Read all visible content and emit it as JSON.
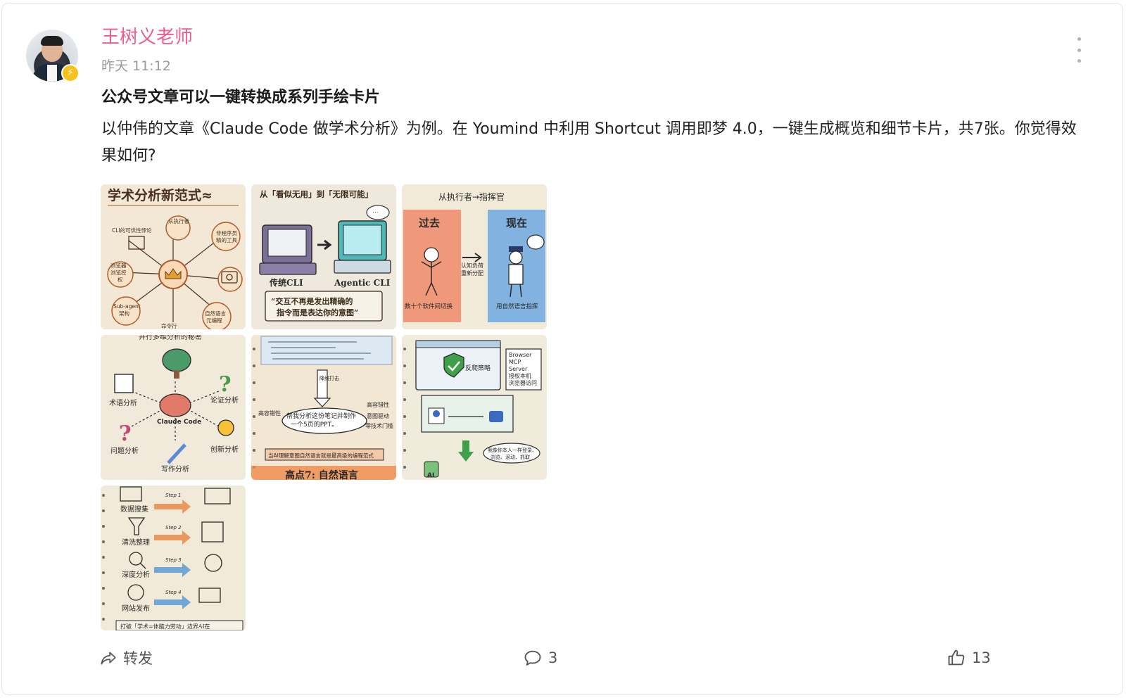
{
  "post": {
    "author": "王树义老师",
    "time": "昨天 11:12",
    "title": "公众号文章可以一键转换成系列手绘卡片",
    "body": "以仲伟的文章《Claude Code 做学术分析》为例。在 Youmind 中利用 Shortcut 调用即梦 4.0，一键生成概览和细节卡片，共7张。你觉得效果如何?"
  },
  "images": [
    {
      "title": "学术分析新范式≈",
      "labels": [
        "CLI的可供性悖论",
        "从执行者",
        "非程序员",
        "精的工具",
        "浏览器",
        "浏览控",
        "权",
        "Sub-agent",
        "架构",
        "自然语言",
        "元编程",
        "命令行"
      ]
    },
    {
      "title": "从「看似无用」到「无限可能」",
      "labels": [
        "传统CLI",
        "Agentic CLI",
        "“交互不再是发出精确的",
        "指令而是表达你的意图”"
      ]
    },
    {
      "title": "从执行者→指挥官",
      "labels": [
        "过去",
        "现在",
        "认知负荷",
        "重新分配",
        "数十个软件间切换",
        "用自然语言指挥"
      ]
    },
    {
      "title": "并行多维分析的秘密",
      "labels": [
        "术语分析",
        "论证分析",
        "Claude Code",
        "问题分析",
        "创新分析",
        "写作分析"
      ]
    },
    {
      "title": "高点7: 自然语言",
      "labels": [
        "降维打击",
        "高容错性",
        "意图驱动",
        "零技术门槛",
        "高容错性",
        "帮我分析这份笔记并制作",
        "一个5页的PPT。",
        "当AI理解意图自然语言就是最高级的编程范式"
      ]
    },
    {
      "title": "",
      "labels": [
        "Browser",
        "MCP",
        "Server",
        "授权本机",
        "浏览器访问",
        "反爬策略",
        "我像你本人一样登录、",
        "浏览、滚动、抓取",
        "AI"
      ]
    },
    {
      "title": "打破「学术=体脑力劳动」边界AI在",
      "labels": [
        "数据搜集",
        "清洗整理",
        "深度分析",
        "网站发布",
        "Step 1",
        "Step 2",
        "Step 3",
        "Step 4"
      ]
    }
  ],
  "actions": {
    "share_label": "转发",
    "comment_count": "3",
    "like_count": "13"
  },
  "colors": {
    "author": "#ee5b8f",
    "time": "#9a9a9a",
    "paper": "#f3e8d6",
    "ink": "#4a3020",
    "accent_orange": "#e98a4a",
    "accent_blue": "#5b9bd5",
    "accent_teal": "#4fb8b8",
    "accent_green": "#3fa04a"
  },
  "icons": {
    "badge": "lightning-badge-icon",
    "more": "more-vertical-icon",
    "share": "share-icon",
    "comment": "comment-icon",
    "like": "thumbs-up-icon"
  }
}
